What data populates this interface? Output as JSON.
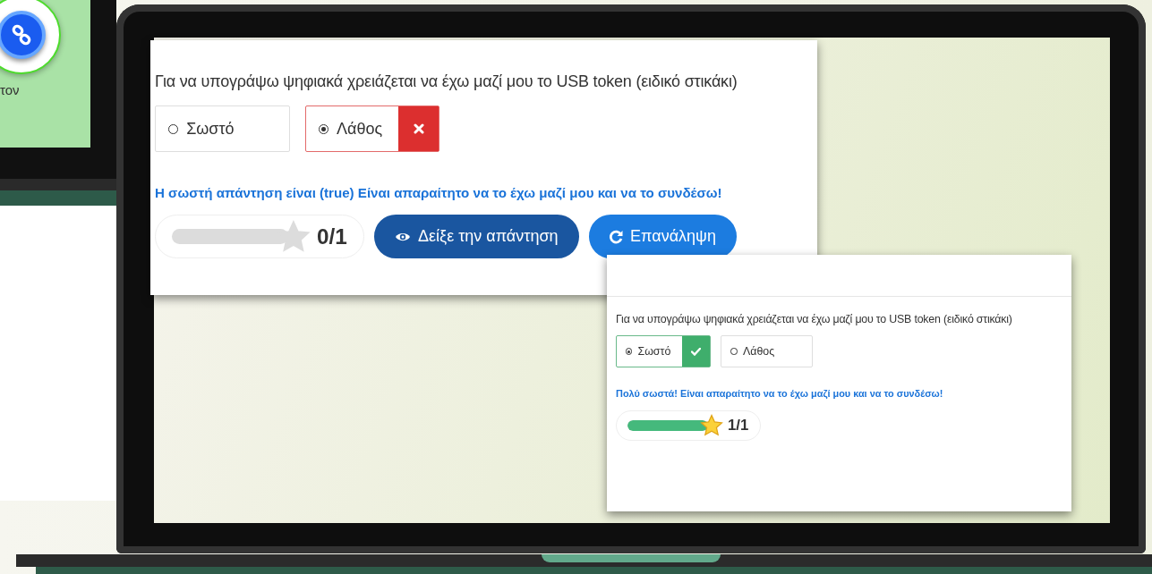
{
  "left_panel": {
    "caption": "τον"
  },
  "cards": [
    {
      "question": "Για να υπογράψω ψηφιακά χρειάζεται να έχω μαζί μου το USB token (ειδικό στικάκι)",
      "options": [
        {
          "label": "Σωστό",
          "selected": false
        },
        {
          "label": "Λάθος",
          "selected": true,
          "correct": false
        }
      ],
      "feedback": "Η σωστή απάντηση είναι (true) Είναι απαραίτητο να το έχω μαζί μου και να το συνδέσω!",
      "score": {
        "level": 0,
        "star_filled": false,
        "text": "0/1"
      },
      "buttons": [
        {
          "label": "Δείξε την απάντηση",
          "kind": "show"
        },
        {
          "label": "Επανάληψη",
          "kind": "retry"
        }
      ]
    },
    {
      "question": "Για να υπογράψω ψηφιακά χρειάζεται να έχω μαζί μου το USB token (ειδικό στικάκι)",
      "options": [
        {
          "label": "Σωστό",
          "selected": true,
          "correct": true
        },
        {
          "label": "Λάθος",
          "selected": false
        }
      ],
      "feedback": "Πολύ σωστά! Είναι απαραίτητο να το έχω μαζί μου και να το συνδέσω!",
      "score": {
        "level": 1,
        "star_filled": true,
        "text": "1/1"
      }
    }
  ]
}
